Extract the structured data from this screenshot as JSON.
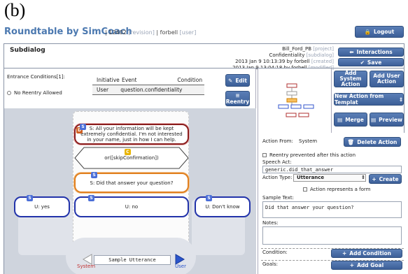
{
  "figure_label": "(b)",
  "brand": {
    "name": "Roundtable by SimCoach",
    "id": "12402",
    "revision": "[revision]",
    "user": "forbell",
    "user_tag": "[user]"
  },
  "logout_label": "Logout",
  "subdialog_title": "Subdialog",
  "meta": {
    "project_name": "Bill_Ford_PB",
    "project_tag": "[project]",
    "subdialog_name": "Confidentiality",
    "subdialog_tag": "[subdialog]",
    "created": "2013 Jan 9 10:13:39 by forbell",
    "created_tag": "[created]",
    "modified": "2013 Jan 9 13:04:18 by forbell",
    "modified_tag": "[modified]"
  },
  "interactions_label": "Interactions",
  "save_label": "Save",
  "entrance": {
    "title": "Entrance Conditions[1]:",
    "no_reentry": "No Reentry Allowed",
    "headers": [
      "Initiative",
      "Event",
      "Condition"
    ],
    "rows": [
      [
        "User",
        "question.confidentiality",
        ""
      ]
    ],
    "edit_label": "Edit",
    "reentry_label": "Reentry"
  },
  "actions": {
    "add_system": "Add System Action",
    "add_user": "Add User Action",
    "new_from_template": "New Action from Templat",
    "merge": "Merge",
    "preview": "Preview"
  },
  "nodes": {
    "s1": "S: All your information will be kept extremely confidential. I'm not interested in your name, just in how I can help.",
    "c1": "or([skipConfirmation])",
    "s2": "S: Did that answer your question?",
    "u_yes": "U: yes",
    "u_no": "U: no",
    "u_dk": "U: Don't know",
    "badge_s": "S",
    "badge_c": "C",
    "badge_d": "D"
  },
  "bottom": {
    "system": "System",
    "user": "User",
    "utterance": "Sample Utterance"
  },
  "action_form": {
    "action_from_label": "Action From:",
    "action_from_value": "System",
    "delete_label": "Delete Action",
    "reentry_prevented": "Reentry prevented after this action",
    "speech_act_label": "Speech Act:",
    "speech_act_value": "generic.did_that_answer",
    "action_type_label": "Action Type:",
    "action_type_value": "Utterance",
    "create_label": "Create",
    "represents_form": "Action represents a form",
    "sample_text_label": "Sample Text:",
    "sample_text_value": "Did that answer your question?",
    "notes_label": "Notes:",
    "condition_label": "Condition:",
    "add_condition": "Add Condition",
    "goals_label": "Goals:",
    "add_goal": "Add Goal"
  },
  "colors": {
    "accent": "#3c5f98",
    "brand": "#4c79b0",
    "system_badge": "#4b6fd8",
    "condition_badge": "#e8b400",
    "red": "#b03030"
  }
}
